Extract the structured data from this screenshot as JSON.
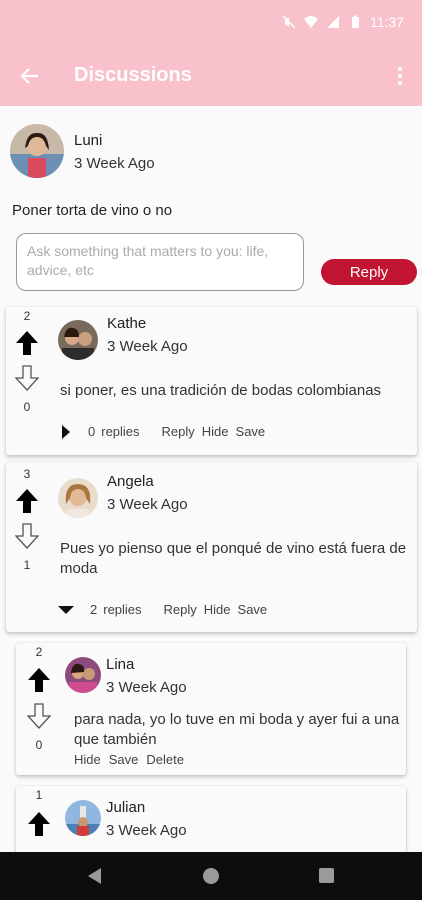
{
  "status_bar": {
    "time": "11:37"
  },
  "app_bar": {
    "title": "Discussions"
  },
  "post": {
    "author": "Luni",
    "time": "3 Week Ago",
    "body": "Poner torta de vino o no"
  },
  "composer": {
    "placeholder": "Ask something that matters to you: life, advice, etc",
    "reply_label": "Reply"
  },
  "comments": [
    {
      "author": "Kathe",
      "time": "3 Week Ago",
      "body": "si poner, es una tradición de bodas colombianas",
      "upvotes": "2",
      "downvotes": "0",
      "reply_count": "0",
      "replies_label": "replies",
      "reply_label": "Reply",
      "hide_label": "Hide",
      "save_label": "Save"
    },
    {
      "author": "Angela",
      "time": "3 Week Ago",
      "body": "Pues yo pienso que el ponqué de vino está fuera de moda",
      "upvotes": "3",
      "downvotes": "1",
      "reply_count": "2",
      "replies_label": "replies",
      "reply_label": "Reply",
      "hide_label": "Hide",
      "save_label": "Save"
    }
  ],
  "replies": [
    {
      "author": "Lina",
      "time": "3 Week Ago",
      "body": "para nada, yo lo tuve en mi boda y ayer fui a una que también",
      "upvotes": "2",
      "downvotes": "0",
      "hide_label": "Hide",
      "save_label": "Save",
      "delete_label": "Delete"
    },
    {
      "author": "Julian",
      "time": "3 Week Ago",
      "upvotes": "1"
    }
  ],
  "icons": {
    "back": "arrow-left-icon",
    "more": "more-vertical-icon",
    "upvote": "arrow-up-filled-icon",
    "downvote": "arrow-down-outline-icon"
  },
  "colors": {
    "app_bar": "#f8c1cb",
    "accent": "#c21533",
    "nav_bar": "#0d0d0d"
  }
}
